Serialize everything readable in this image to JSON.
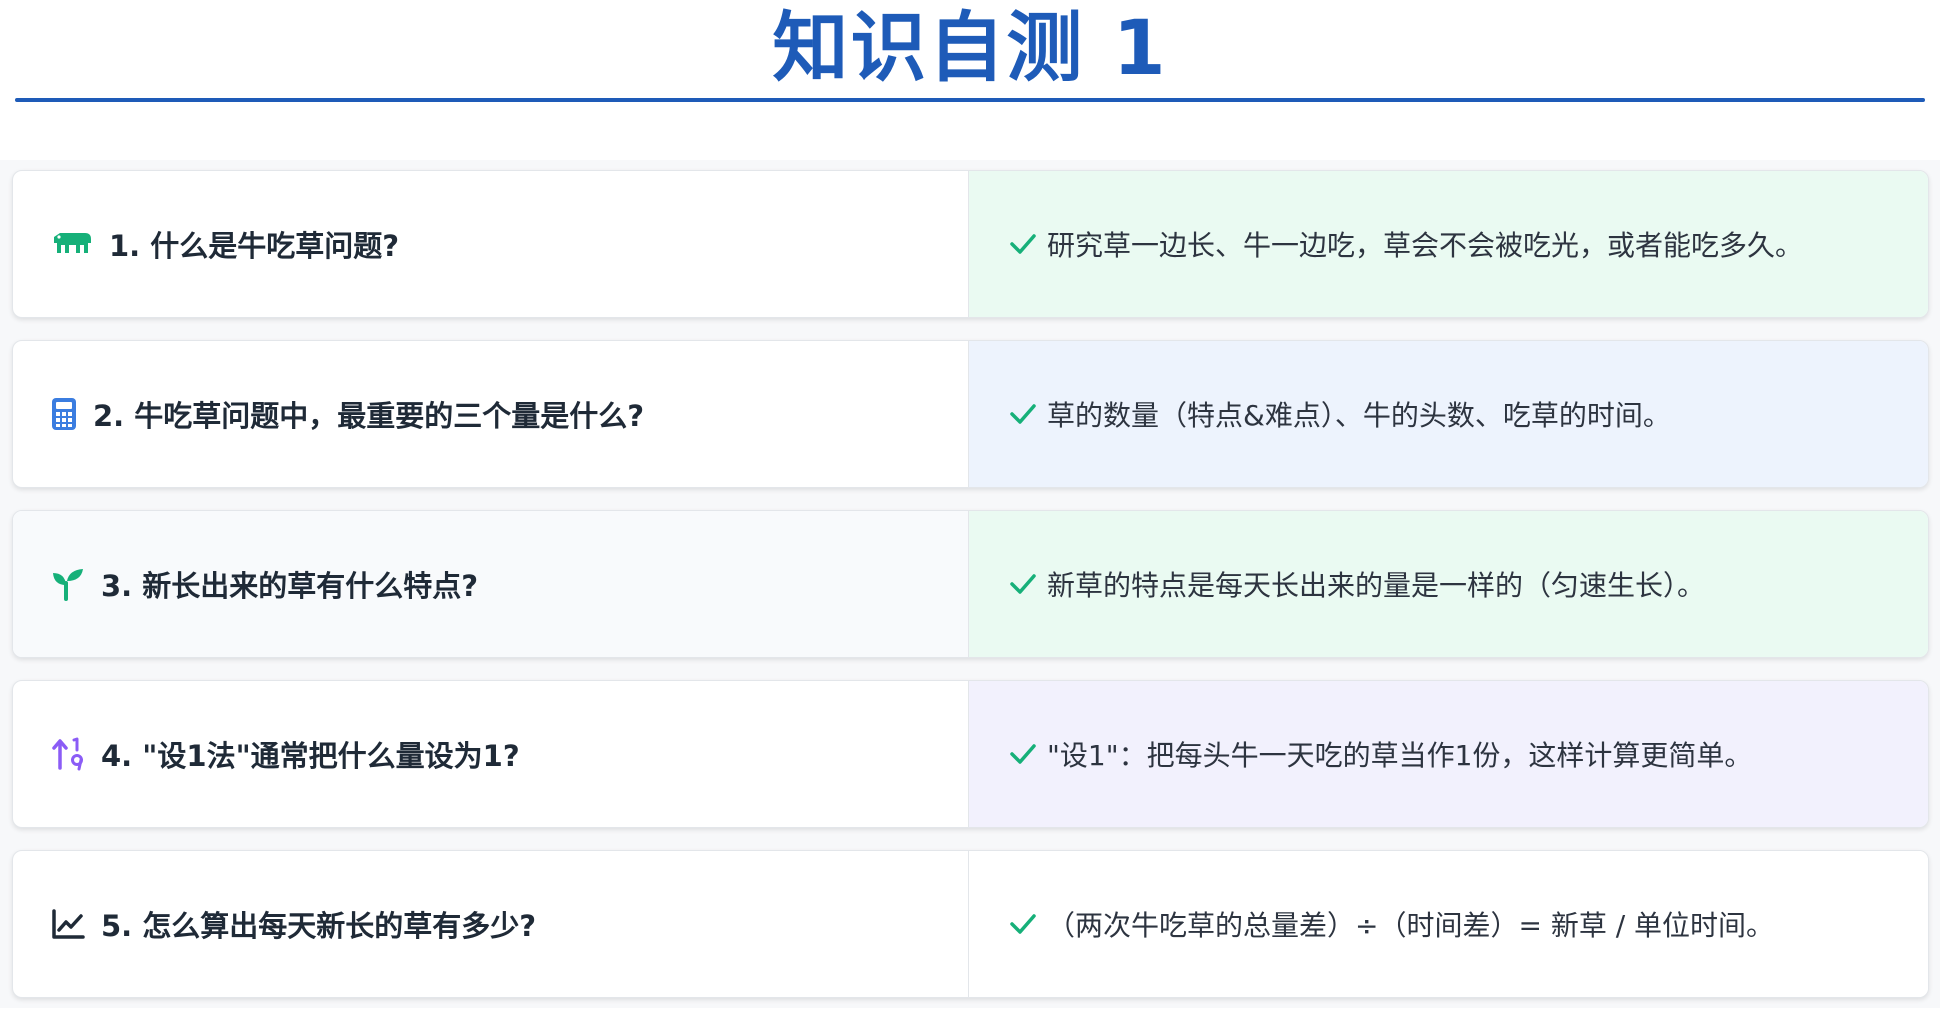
{
  "title": "知识自测 1",
  "colors": {
    "title": "#1e5bb8",
    "check": "#16b079",
    "cow_icon": "#16b079",
    "calc_icon": "#3b7de0",
    "sprout_icon": "#16b079",
    "sort_icon": "#8b5cf6",
    "chart_icon": "#1f2a37"
  },
  "items": [
    {
      "icon": "cow-icon",
      "question": "1. 什么是牛吃草问题?",
      "answer": "研究草一边长、牛一边吃，草会不会被吃光，或者能吃多久。"
    },
    {
      "icon": "calculator-icon",
      "question": "2. 牛吃草问题中，最重要的三个量是什么?",
      "answer": "草的数量（特点&难点）、牛的头数、吃草的时间。"
    },
    {
      "icon": "seedling-icon",
      "question": "3. 新长出来的草有什么特点?",
      "answer": "新草的特点是每天长出来的量是一样的（匀速生长）。"
    },
    {
      "icon": "sort-numeric-icon",
      "question": "4. \"设1法\"通常把什么量设为1?",
      "answer": "\"设1\"：把每头牛一天吃的草当作1份，这样计算更简单。"
    },
    {
      "icon": "line-chart-icon",
      "question": "5. 怎么算出每天新长的草有多少?",
      "answer": "（两次牛吃草的总量差）÷（时间差）= 新草 / 单位时间。"
    }
  ]
}
